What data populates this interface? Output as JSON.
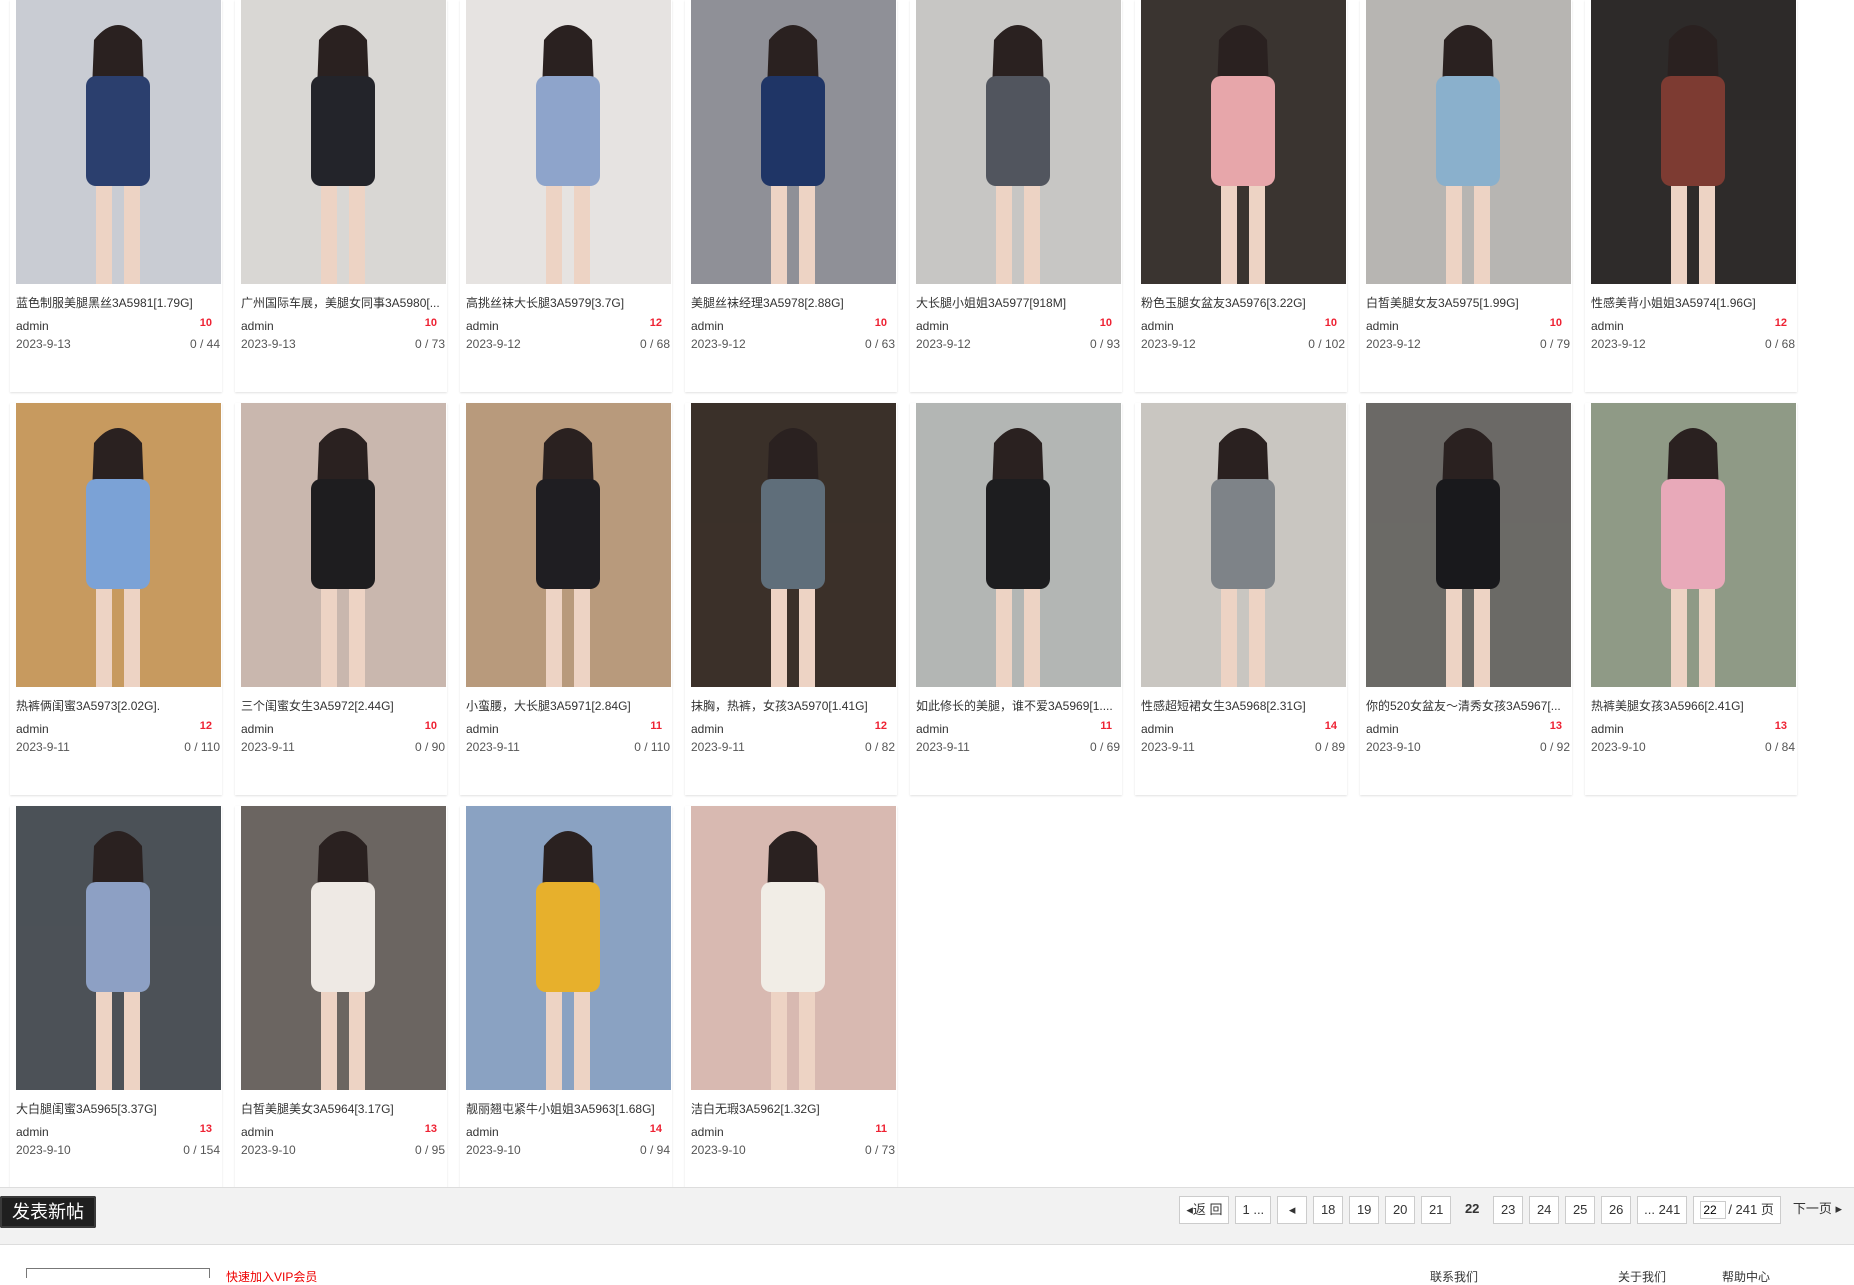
{
  "posts": [
    {
      "title": "蓝色制服美腿黑丝3A5981[1.79G]",
      "author": "admin",
      "date": "2023-9-13",
      "badge": "10",
      "stats": "0 / 44",
      "c1": "#2b3f6e",
      "c2": "#c9ccd3"
    },
    {
      "title": "广州国际车展，美腿女同事3A5980[...",
      "author": "admin",
      "date": "2023-9-13",
      "badge": "10",
      "stats": "0 / 73",
      "c1": "#23242a",
      "c2": "#d9d7d4"
    },
    {
      "title": "高挑丝袜大长腿3A5979[3.7G]",
      "author": "admin",
      "date": "2023-9-12",
      "badge": "12",
      "stats": "0 / 68",
      "c1": "#8ea4cb",
      "c2": "#e6e3e1"
    },
    {
      "title": "美腿丝袜经理3A5978[2.88G]",
      "author": "admin",
      "date": "2023-9-12",
      "badge": "10",
      "stats": "0 / 63",
      "c1": "#1f3566",
      "c2": "#8f9097"
    },
    {
      "title": "大长腿小姐姐3A5977[918M]",
      "author": "admin",
      "date": "2023-9-12",
      "badge": "10",
      "stats": "0 / 93",
      "c1": "#51555e",
      "c2": "#c7c6c4"
    },
    {
      "title": "粉色玉腿女盆友3A5976[3.22G]",
      "author": "admin",
      "date": "2023-9-12",
      "badge": "10",
      "stats": "0 / 102",
      "c1": "#e7a6aa",
      "c2": "#3a3430"
    },
    {
      "title": "白皙美腿女友3A5975[1.99G]",
      "author": "admin",
      "date": "2023-9-12",
      "badge": "10",
      "stats": "0 / 79",
      "c1": "#8ab0cc",
      "c2": "#b7b5b2"
    },
    {
      "title": "性感美背小姐姐3A5974[1.96G]",
      "author": "admin",
      "date": "2023-9-12",
      "badge": "12",
      "stats": "0 / 68",
      "c1": "#7d3b32",
      "c2": "#2e2b2a"
    },
    {
      "title": "热裤俩闺蜜3A5973[2.02G].",
      "author": "admin",
      "date": "2023-9-11",
      "badge": "12",
      "stats": "0 / 110",
      "c1": "#7ba2d6",
      "c2": "#c79a5f"
    },
    {
      "title": "三个闺蜜女生3A5972[2.44G]",
      "author": "admin",
      "date": "2023-9-11",
      "badge": "10",
      "stats": "0 / 90",
      "c1": "#1e1d1f",
      "c2": "#c9b7ae"
    },
    {
      "title": "小蛮腰，大长腿3A5971[2.84G]",
      "author": "admin",
      "date": "2023-9-11",
      "badge": "11",
      "stats": "0 / 110",
      "c1": "#1f1e22",
      "c2": "#b89a7c"
    },
    {
      "title": "抹胸，热裤，女孩3A5970[1.41G]",
      "author": "admin",
      "date": "2023-9-11",
      "badge": "12",
      "stats": "0 / 82",
      "c1": "#5f6e7a",
      "c2": "#3b3029"
    },
    {
      "title": "如此修长的美腿，谁不爱3A5969[1....",
      "author": "admin",
      "date": "2023-9-11",
      "badge": "11",
      "stats": "0 / 69",
      "c1": "#1d1d1f",
      "c2": "#b3b6b4"
    },
    {
      "title": "性感超短裙女生3A5968[2.31G]",
      "author": "admin",
      "date": "2023-9-11",
      "badge": "14",
      "stats": "0 / 89",
      "c1": "#7e8388",
      "c2": "#c9c6c1"
    },
    {
      "title": "你的520女盆友～清秀女孩3A5967[...",
      "author": "admin",
      "date": "2023-9-10",
      "badge": "13",
      "stats": "0 / 92",
      "c1": "#19191c",
      "c2": "#6b6a66"
    },
    {
      "title": "热裤美腿女孩3A5966[2.41G]",
      "author": "admin",
      "date": "2023-9-10",
      "badge": "13",
      "stats": "0 / 84",
      "c1": "#e8a9b9",
      "c2": "#8f9a86"
    },
    {
      "title": "大白腿闺蜜3A5965[3.37G]",
      "author": "admin",
      "date": "2023-9-10",
      "badge": "13",
      "stats": "0 / 154",
      "c1": "#8da0c4",
      "c2": "#4c5157"
    },
    {
      "title": "白皙美腿美女3A5964[3.17G]",
      "author": "admin",
      "date": "2023-9-10",
      "badge": "13",
      "stats": "0 / 95",
      "c1": "#eee9e4",
      "c2": "#6b6561"
    },
    {
      "title": "靓丽翘屯紧牛小姐姐3A5963[1.68G]",
      "author": "admin",
      "date": "2023-9-10",
      "badge": "14",
      "stats": "0 / 94",
      "c1": "#e7b02c",
      "c2": "#8aa2c2"
    },
    {
      "title": "洁白无瑕3A5962[1.32G]",
      "author": "admin",
      "date": "2023-9-10",
      "badge": "11",
      "stats": "0 / 73",
      "c1": "#f1ede6",
      "c2": "#d8b9b1"
    }
  ],
  "toolbar": {
    "new_post": "发表新帖"
  },
  "pager": {
    "back": "返 回",
    "first": "1 ...",
    "pages": [
      "18",
      "19",
      "20",
      "21",
      "22",
      "23",
      "24",
      "25",
      "26"
    ],
    "current": "22",
    "last": "... 241",
    "input_value": "22",
    "total": "/ 241 页",
    "next": "下一页"
  },
  "footer": {
    "red_text": "快速加入VIP会员",
    "link1": "联系我们",
    "link2": "关于我们",
    "link3": "帮助中心"
  }
}
